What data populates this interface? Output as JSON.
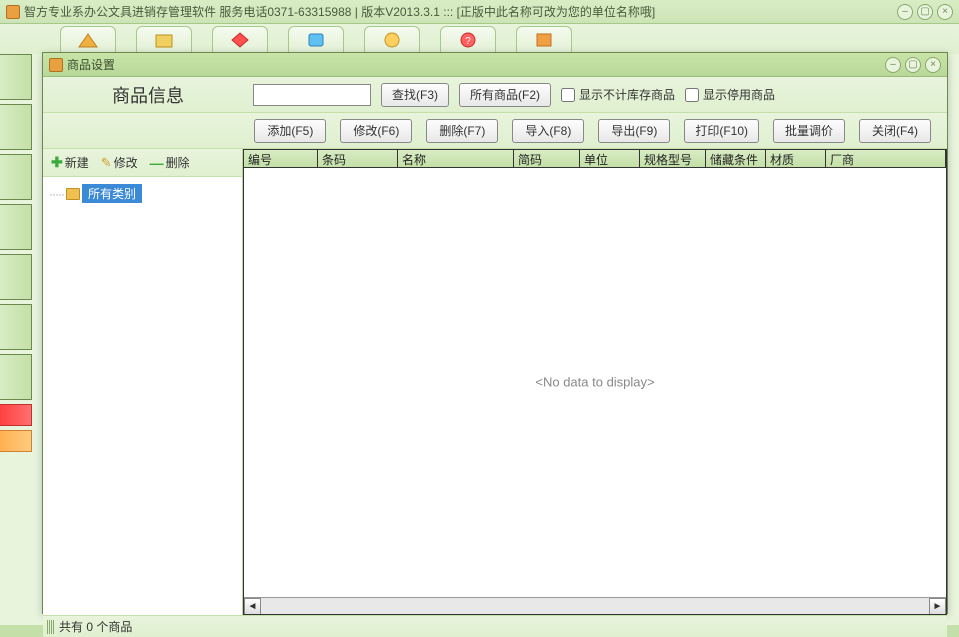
{
  "app": {
    "title": "智方专业系办公文具进销存管理软件  服务电话0371-63315988 | 版本V2013.3.1 ::: [正版中此名称可改为您的单位名称哦]"
  },
  "dialog": {
    "title": "商品设置",
    "heading": "商品信息",
    "search_btn": "查找(F3)",
    "all_btn": "所有商品(F2)",
    "cb_hide_stock": "显示不计库存商品",
    "cb_show_disabled": "显示停用商品",
    "actions": {
      "add": "添加(F5)",
      "modify": "修改(F6)",
      "delete": "删除(F7)",
      "import": "导入(F8)",
      "export": "导出(F9)",
      "print": "打印(F10)",
      "batch": "批量调价",
      "close": "关闭(F4)"
    }
  },
  "tree": {
    "new": "新建",
    "edit": "修改",
    "del": "删除",
    "root": "所有类别"
  },
  "grid": {
    "cols": [
      "编号",
      "条码",
      "名称",
      "简码",
      "单位",
      "规格型号",
      "储藏条件",
      "材质",
      "厂商"
    ],
    "empty": "<No data to display>"
  },
  "status": "共有 0 个商品"
}
